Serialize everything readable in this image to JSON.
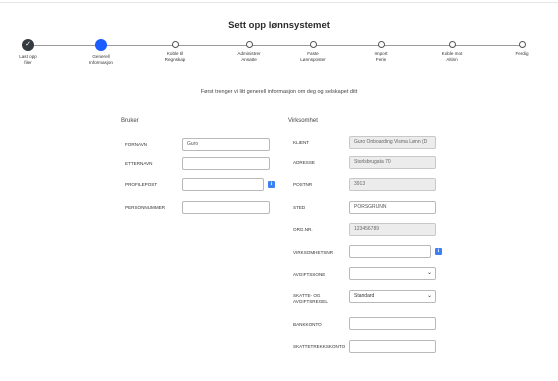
{
  "title": "Sett opp lønnsystemet",
  "steps": [
    {
      "label": "Last opp\nfiler",
      "state": "done"
    },
    {
      "label": "Generell\nInformasjon",
      "state": "active"
    },
    {
      "label": "Koble til\nRegnskap",
      "state": "todo"
    },
    {
      "label": "Administrer\nAnsatte",
      "state": "todo"
    },
    {
      "label": "Faste\nLønnsposter",
      "state": "todo"
    },
    {
      "label": "Import\nFerie",
      "state": "todo"
    },
    {
      "label": "Koble mot\nAltinn",
      "state": "todo"
    },
    {
      "label": "Ferdig",
      "state": "todo"
    }
  ],
  "intro": "Først trenger vi litt generell informasjon om deg og selskapet ditt",
  "user": {
    "title": "Bruker",
    "fornavn_label": "FORNAVN",
    "fornavn_value": "Guro",
    "etternavn_label": "ETTERNAVN",
    "etternavn_value": "",
    "profil_label": "PROFILEPOST",
    "profil_value": "",
    "personnummer_label": "PERSONNUMMER",
    "personnummer_value": ""
  },
  "company": {
    "title": "Virksomhet",
    "klient_label": "KLIENT",
    "klient_value": "Guro Onboarding Visma Lønn (D",
    "adresse_label": "ADRESSE",
    "adresse_value": "Storlsbrugata 70",
    "postnr_label": "POSTNR",
    "postnr_value": "3913",
    "sted_label": "STED",
    "sted_value": "PORSGRUNN",
    "orgnr_label": "ORG.NR.",
    "orgnr_value": "123456789",
    "virksomhetsnr_label": "VIRKSOMHETSNR",
    "virksomhetsnr_value": "",
    "avgiftssone_label": "AVGIFTSSONE",
    "avgiftssone_value": "",
    "skatte_label": "SKATTE- OG\nAVGIFTSREGEL",
    "skatte_value": "Standard",
    "bankkonto_label": "BANKKONTO",
    "bankkonto_value": "",
    "skattetrekk_label": "SKATTETREKKSKONTO",
    "skattetrekk_value": ""
  },
  "info_glyph": "i",
  "check_glyph": "✓",
  "chevron_glyph": "⌄"
}
